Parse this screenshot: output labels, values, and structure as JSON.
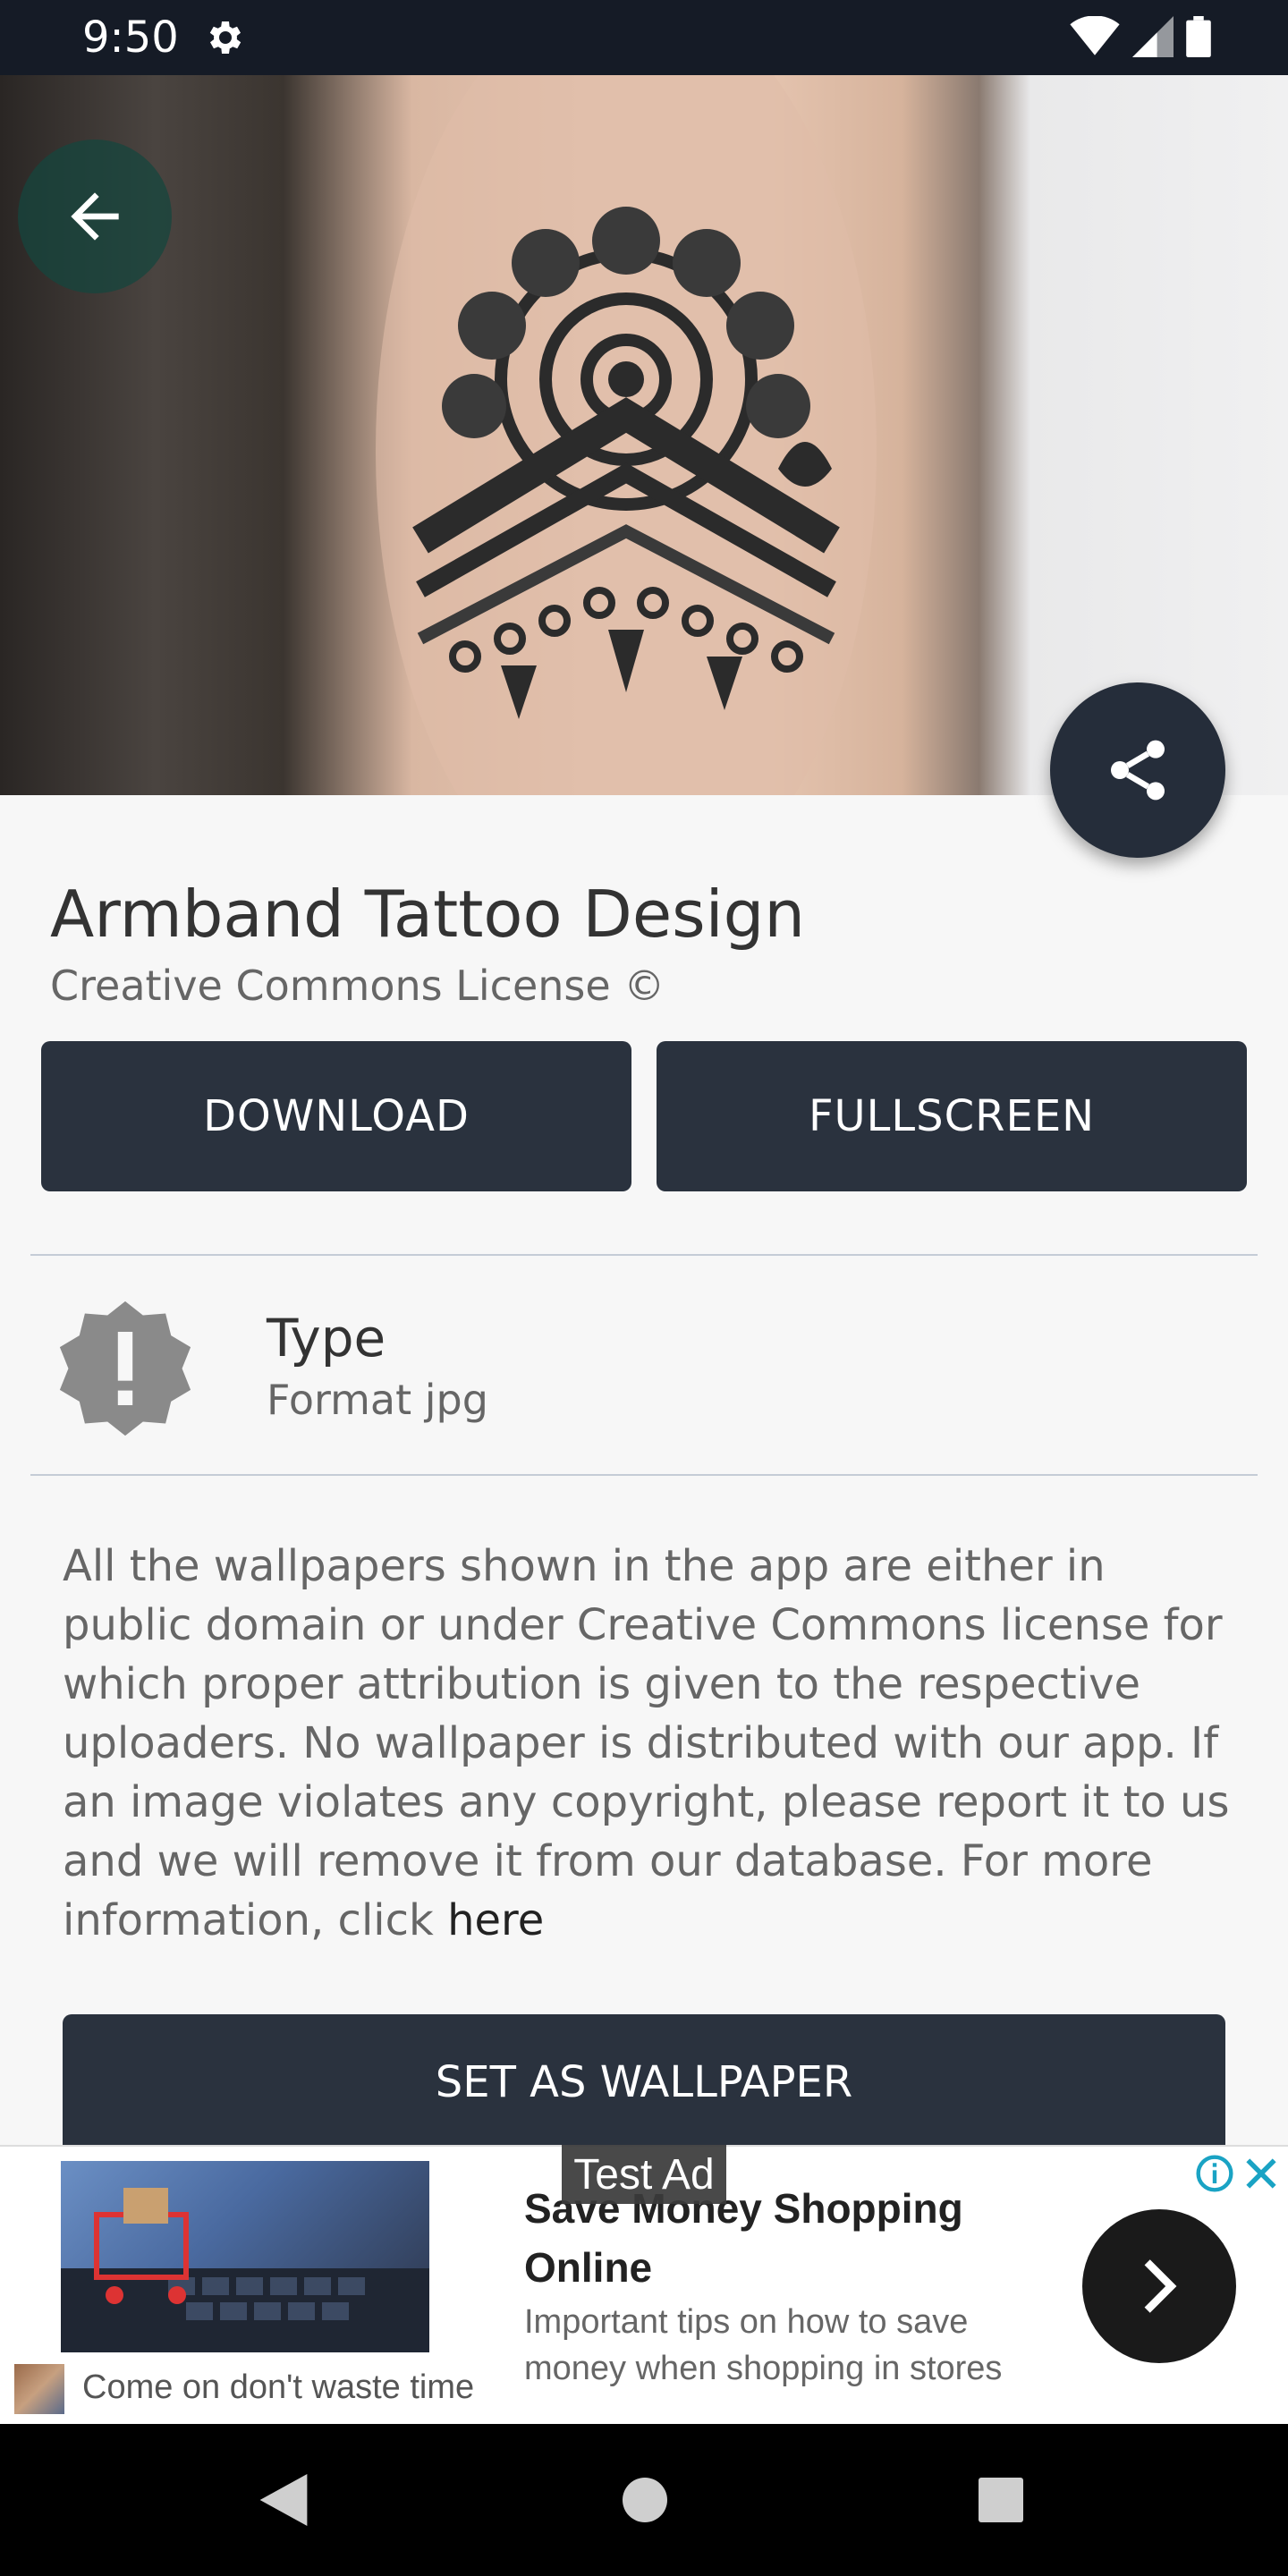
{
  "status_bar": {
    "time": "9:50"
  },
  "header": {
    "back_icon": "arrow-left-icon",
    "share_icon": "share-icon"
  },
  "wallpaper": {
    "title": "Armband Tattoo Design",
    "license": "Creative Commons License ©"
  },
  "actions": {
    "download_label": "DOWNLOAD",
    "fullscreen_label": "FULLSCREEN",
    "set_wallpaper_label": "SET AS WALLPAPER"
  },
  "info": {
    "icon": "alert-badge-icon",
    "label": "Type",
    "value": "Format jpg"
  },
  "disclaimer": {
    "text": "All the wallpapers shown in the app are either in public domain or under Creative Commons license for which proper attribution is given to the respective uploaders. No wallpaper is distributed with our app. If an image violates any copyright, please report it to us and we will remove it from our database. For more information, click ",
    "link": "here"
  },
  "ad": {
    "label": "Test Ad",
    "title": "Save Money Shopping Online",
    "body": "Important tips on how to save money when shopping in stores",
    "tagline": "Come on don't waste time"
  },
  "colors": {
    "primary": "#2a323e",
    "status_bar": "#151b26",
    "background": "#f7f7f7"
  }
}
